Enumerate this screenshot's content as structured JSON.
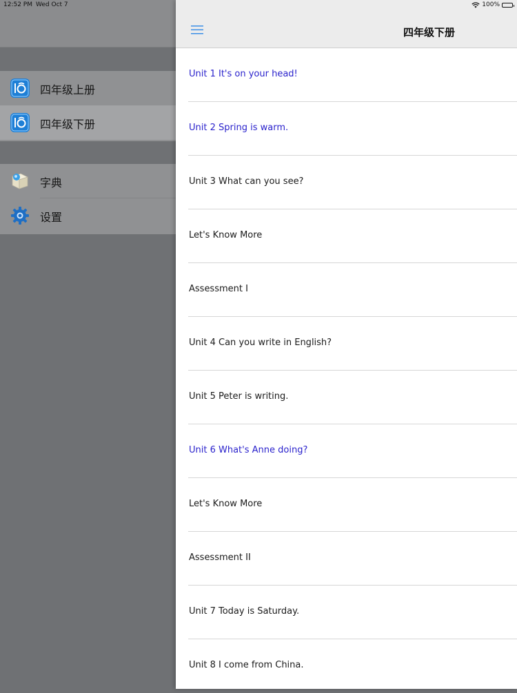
{
  "status_bar": {
    "time": "12:52 PM",
    "date": "Wed Oct 7",
    "battery": "100%"
  },
  "sidebar": {
    "books": [
      {
        "label": "四年级上册",
        "icon": "book-app-icon",
        "selected": false
      },
      {
        "label": "四年级下册",
        "icon": "book-app-icon",
        "selected": true
      }
    ],
    "tools": [
      {
        "label": "字典",
        "icon": "dictionary-icon"
      },
      {
        "label": "设置",
        "icon": "gear-icon"
      }
    ]
  },
  "main": {
    "title": "四年级下册",
    "menu_icon": "menu-icon",
    "units": [
      {
        "label": "Unit 1 It's on your head!",
        "highlight": true
      },
      {
        "label": "Unit 2 Spring is warm.",
        "highlight": true
      },
      {
        "label": "Unit 3 What can you see?",
        "highlight": false
      },
      {
        "label": "Let's Know More",
        "highlight": false
      },
      {
        "label": "Assessment I",
        "highlight": false
      },
      {
        "label": "Unit 4 Can you write in English?",
        "highlight": false
      },
      {
        "label": "Unit 5 Peter is writing.",
        "highlight": false
      },
      {
        "label": "Unit 6 What's Anne doing?",
        "highlight": true
      },
      {
        "label": "Let's Know More",
        "highlight": false
      },
      {
        "label": "Assessment II",
        "highlight": false
      },
      {
        "label": "Unit 7 Today is Saturday.",
        "highlight": false
      },
      {
        "label": "Unit 8 I come from China.",
        "highlight": false
      }
    ]
  },
  "colors": {
    "highlight_text": "#2a22cc",
    "accent": "#3a8ee6"
  }
}
